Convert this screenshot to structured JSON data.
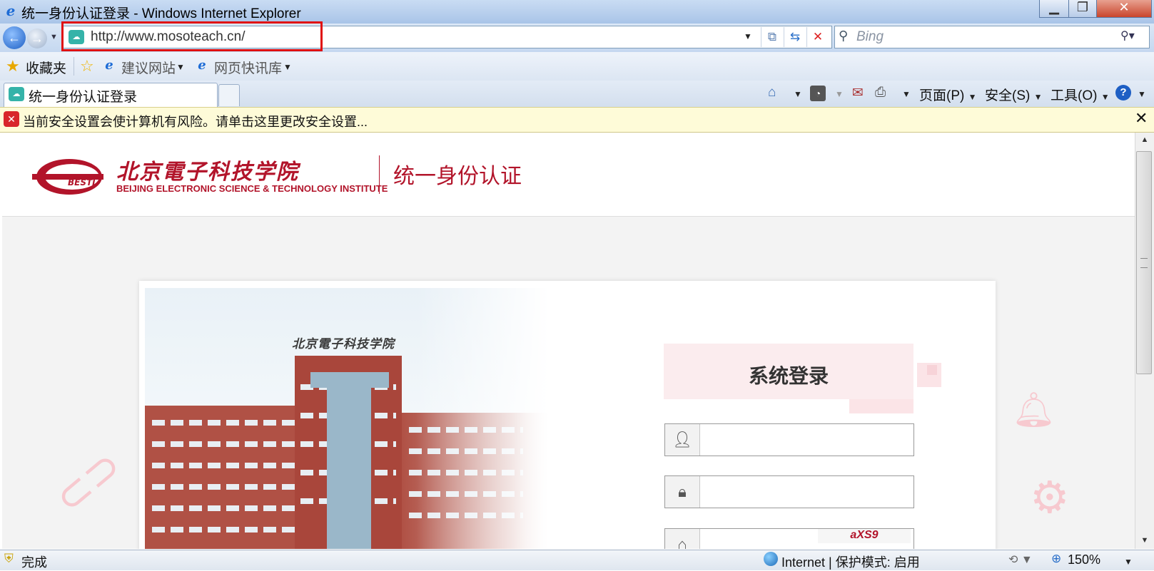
{
  "window": {
    "title": "统一身份认证登录 - Windows Internet Explorer"
  },
  "nav": {
    "url": "http://www.mosoteach.cn/",
    "search_placeholder": "Bing"
  },
  "favorites": {
    "favorites_label": "收藏夹",
    "suggested_sites": "建议网站",
    "web_slice_gallery": "网页快讯库"
  },
  "tab": {
    "label": "统一身份认证登录"
  },
  "command_bar": {
    "page": "页面(P)",
    "safety": "安全(S)",
    "tools": "工具(O)"
  },
  "info_bar": {
    "message": "当前安全设置会使计算机有风险。请单击这里更改安全设置..."
  },
  "site": {
    "logo_cn": "北京電子科技学院",
    "logo_en": "BEIJING ELECTRONIC SCIENCE & TECHNOLOGY INSTITUTE",
    "header_title": "统一身份认证",
    "photo_sign": "北京電子科技学院",
    "login_title": "系统登录",
    "captcha_text": "aXS9"
  },
  "status_bar": {
    "status": "完成",
    "zone": "Internet | 保护模式: 启用",
    "zoom": "150%"
  },
  "colors": {
    "brand_red": "#b2142a",
    "highlight_red": "#e01010",
    "deco_pink": "#f7c9cf"
  },
  "icons": [
    "ie-logo-icon",
    "back-icon",
    "forward-icon",
    "page-favicon-icon",
    "compat-view-icon",
    "refresh-icon",
    "stop-icon",
    "search-icon",
    "star-icon",
    "add-favorite-icon",
    "home-icon",
    "feeds-icon",
    "read-mail-icon",
    "print-icon",
    "help-icon",
    "security-warning-icon",
    "close-icon",
    "user-icon",
    "lock-icon",
    "paperclip-icon",
    "bell-icon",
    "gear-icon",
    "protected-mode-icon",
    "globe-icon",
    "zoom-icon"
  ]
}
